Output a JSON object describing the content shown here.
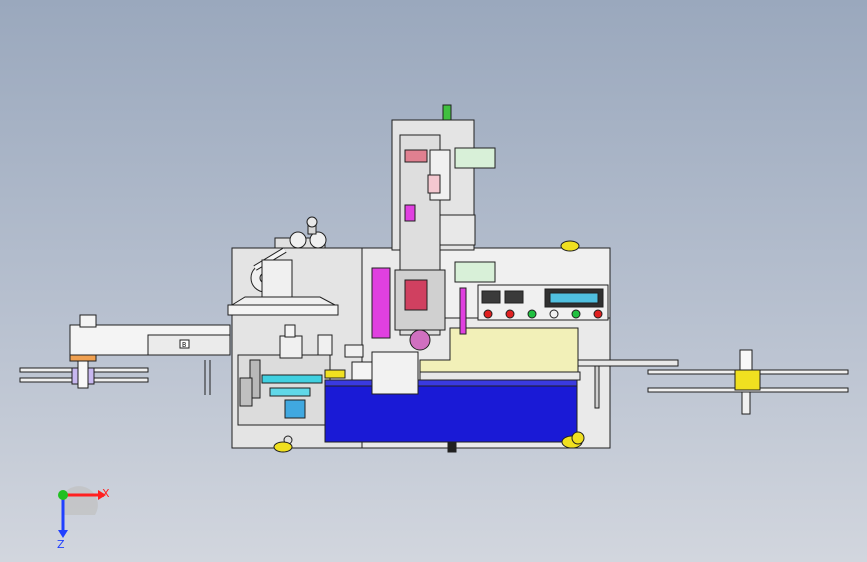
{
  "viewport": {
    "background_top": "#9aa8bd",
    "background_bottom": "#d2d6de"
  },
  "machine": {
    "frame_color": "#e8e8e8",
    "outline_color": "#202020",
    "base_tank_color": "#1a1ad6",
    "top_table_color": "#f2f0b8",
    "accent_magenta": "#e040e0",
    "accent_green": "#40c040",
    "accent_red": "#d03030",
    "accent_cyan": "#40d0e0",
    "accent_yellow": "#f0e020",
    "control_panel": {
      "display": "",
      "indicator_count": 6,
      "indicator_colors": [
        "#e02020",
        "#e02020",
        "#20c040",
        "#f0f0f0",
        "#20c040",
        "#e02020"
      ]
    },
    "left_arm_label": "B"
  },
  "triad": {
    "x_label": "X",
    "y_label": "",
    "z_label": "Z",
    "x_color": "#ff2020",
    "y_color": "#20c020",
    "z_color": "#2040ff"
  }
}
